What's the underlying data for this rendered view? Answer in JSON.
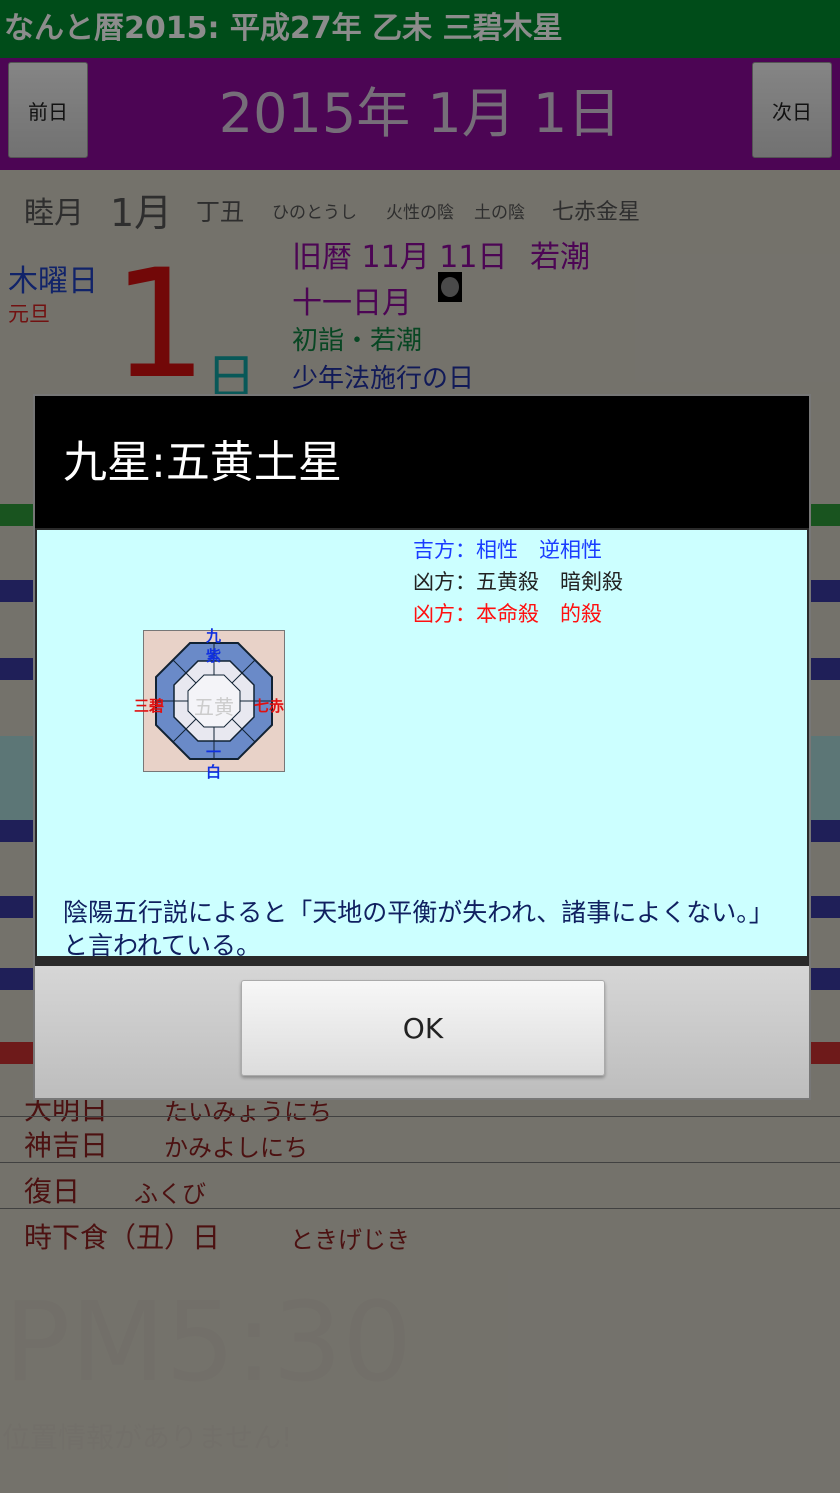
{
  "app_title": "なんと暦2015:  平成27年  乙未  三碧木星",
  "nav": {
    "prev_label": "前日",
    "next_label": "次日",
    "date": "2015年 1月 1日"
  },
  "month_row": {
    "month_name": "睦月",
    "month_num": "1月",
    "eto": "丁丑",
    "eto_reading": "ひのとうし",
    "element1": "火性の陰",
    "element2": "土の陰",
    "star": "七赤金星"
  },
  "day": {
    "weekday": "木曜日",
    "holiday": "元旦",
    "number": "1",
    "suffix": "日"
  },
  "lunar": {
    "date": "旧暦 11月 11日",
    "tide": "若潮",
    "moon_name": "十一日月",
    "event1": "初詣・若潮",
    "event2": "少年法施行の日"
  },
  "lower_rows": [
    {
      "name": "大明日",
      "reading": "たいみょうにち"
    },
    {
      "name": "神吉日",
      "reading": "かみよしにち"
    },
    {
      "name": "復日",
      "reading": "ふくび"
    },
    {
      "name": "時下食（丑）日",
      "reading": "ときげじき"
    }
  ],
  "clock": "PM5:30",
  "location_msg": "位置情報がありません!",
  "dialog": {
    "title": "九星:五黄土星",
    "lucky": "吉方：相性　逆相性",
    "unlucky1": "凶方：五黄殺　暗剣殺",
    "unlucky2": "凶方：本命殺　的殺",
    "diagram": {
      "top": "九",
      "top2": "紫",
      "left": "三碧",
      "center": "五黄",
      "right": "七赤",
      "bottom": "白",
      "bottom2": "一"
    },
    "description": "陰陽五行説によると「天地の平衡が失われ、諸事によくない。」と言われている。",
    "ok_label": "OK"
  },
  "colors": {
    "title_green": "#008a2e",
    "date_purple": "#8a0a9a",
    "dialog_body": "#ccffff",
    "lucky_blue": "#1a3cff",
    "unlucky_red": "#ff1010"
  }
}
